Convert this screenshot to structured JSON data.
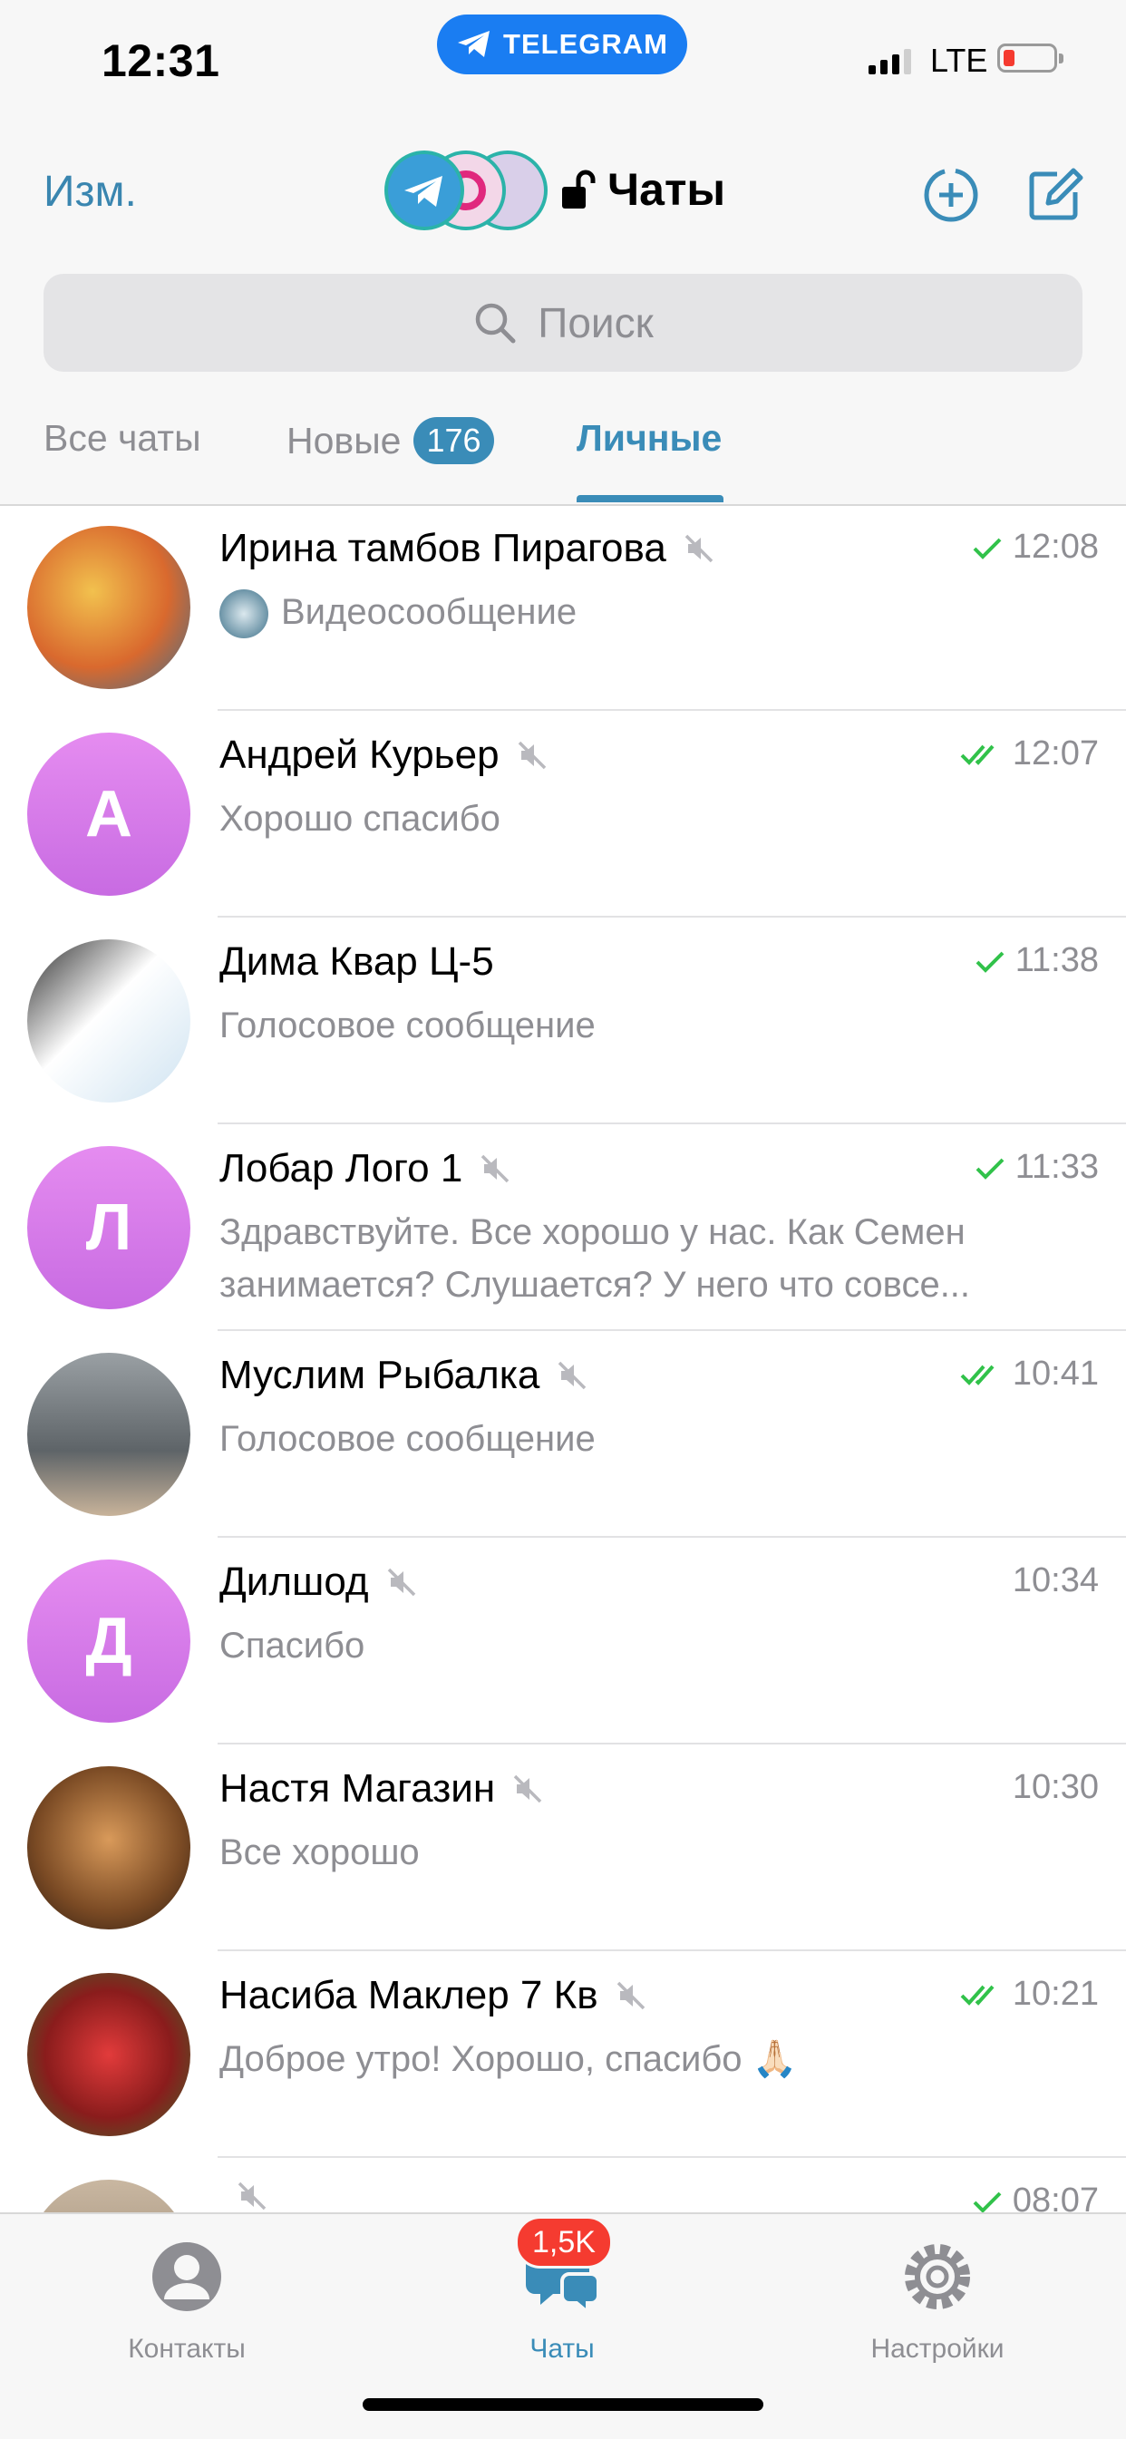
{
  "status_bar": {
    "time": "12:31",
    "app_pill": "TELEGRAM",
    "network": "LTE"
  },
  "nav": {
    "edit_label": "Изм.",
    "title": "Чаты"
  },
  "search": {
    "placeholder": "Поиск"
  },
  "tabs": [
    {
      "label": "Все чаты"
    },
    {
      "label": "Новые",
      "badge": "176"
    },
    {
      "label": "Личные",
      "active": true
    }
  ],
  "chats": [
    {
      "name": "Ирина тамбов Пирагова",
      "time": "12:08",
      "status": "sent",
      "muted": true,
      "preview": "Видеосообщение"
    },
    {
      "name": "Андрей Курьер",
      "time": "12:07",
      "status": "read",
      "muted": true,
      "preview": "Хорошо спасибо",
      "initial": "А"
    },
    {
      "name": "Дима Квар Ц-5",
      "time": "11:38",
      "status": "sent",
      "muted": false,
      "preview": "Голосовое сообщение"
    },
    {
      "name": "Лобар Лого 1",
      "time": "11:33",
      "status": "sent",
      "muted": true,
      "preview": "Здравствуйте. Все хорошо у нас. Как Семен занимается? Слушается? У него что совсе...",
      "initial": "Л"
    },
    {
      "name": "Муслим Рыбалка",
      "time": "10:41",
      "status": "read",
      "muted": true,
      "preview": "Голосовое сообщение"
    },
    {
      "name": "Дилшод",
      "time": "10:34",
      "status": "none",
      "muted": true,
      "preview": "Спасибо",
      "initial": "Д"
    },
    {
      "name": "Настя Магазин",
      "time": "10:30",
      "status": "none",
      "muted": true,
      "preview": "Все хорошо"
    },
    {
      "name": "Насиба Маклер 7 Кв",
      "time": "10:21",
      "status": "read",
      "muted": true,
      "preview": "Доброе утро! Хорошо, спасибо 🙏🏻"
    },
    {
      "name": "",
      "time": "08:07",
      "status": "sent",
      "muted": true,
      "preview": ""
    }
  ],
  "tabbar": {
    "contacts": "Контакты",
    "chats": "Чаты",
    "chats_badge": "1,5K",
    "settings": "Настройки"
  },
  "colors": {
    "accent": "#3a8cb8",
    "check": "#31c24a",
    "badge_red": "#f53b30",
    "telegram_blue": "#1a7df2"
  }
}
